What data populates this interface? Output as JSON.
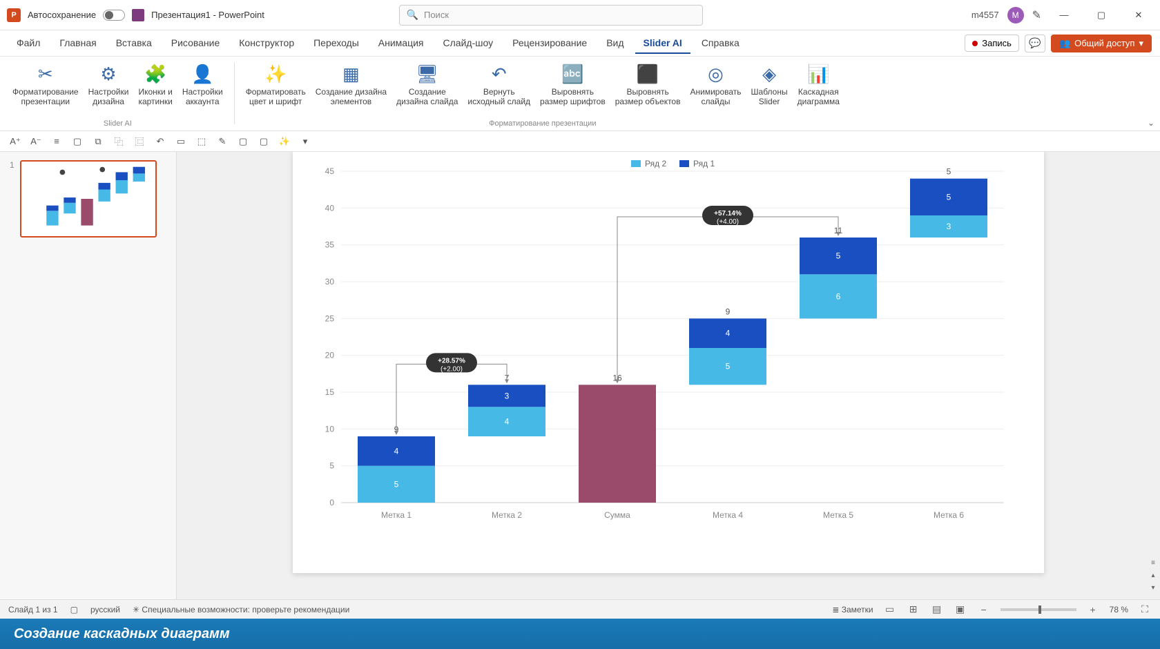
{
  "titlebar": {
    "autosave_label": "Автосохранение",
    "doc_title": "Презентация1 - PowerPoint",
    "search_placeholder": "Поиск",
    "user_name": "m4557",
    "avatar_letter": "M"
  },
  "tabs": {
    "items": [
      "Файл",
      "Главная",
      "Вставка",
      "Рисование",
      "Конструктор",
      "Переходы",
      "Анимация",
      "Слайд-шоу",
      "Рецензирование",
      "Вид",
      "Slider AI",
      "Справка"
    ],
    "active_index": 10,
    "record_label": "Запись",
    "share_label": "Общий доступ"
  },
  "ribbon": {
    "group1_label": "Slider AI",
    "group2_label": "Форматирование презентации",
    "buttons1": [
      {
        "label": "Форматирование\nпрезентации",
        "icon": "✂"
      },
      {
        "label": "Настройки\nдизайна",
        "icon": "⚙"
      },
      {
        "label": "Иконки и\nкартинки",
        "icon": "🧩"
      },
      {
        "label": "Настройки\nаккаунта",
        "icon": "👤"
      }
    ],
    "buttons2": [
      {
        "label": "Форматировать\nцвет и шрифт",
        "icon": "✨"
      },
      {
        "label": "Создание дизайна\nэлементов",
        "icon": "▦"
      },
      {
        "label": "Создание\nдизайна слайда",
        "icon": "🖥"
      },
      {
        "label": "Вернуть\nисходный слайд",
        "icon": "↶"
      },
      {
        "label": "Выровнять\nразмер шрифтов",
        "icon": "🔤"
      },
      {
        "label": "Выровнять\nразмер объектов",
        "icon": "⬛"
      },
      {
        "label": "Анимировать\nслайды",
        "icon": "◎"
      },
      {
        "label": "Шаблоны\nSlider",
        "icon": "◈"
      },
      {
        "label": "Каскадная\nдиаграмма",
        "icon": "📊"
      }
    ]
  },
  "qat": [
    "A⁺",
    "A⁻",
    "≡",
    "▢",
    "⧉",
    "⿻",
    "⿷",
    "↶",
    "▭",
    "⬚",
    "✎",
    "▢",
    "▢",
    "✨",
    "▾"
  ],
  "thumbnails": {
    "slide_number": "1"
  },
  "statusbar": {
    "slide_counter": "Слайд 1 из 1",
    "language": "русский",
    "accessibility": "Специальные возможности: проверьте рекомендации",
    "notes_label": "Заметки",
    "zoom_level": "78 %"
  },
  "caption": "Создание каскадных диаграмм",
  "chart_data": {
    "type": "bar",
    "legend": [
      "Ряд 2",
      "Ряд 1"
    ],
    "categories": [
      "Метка 1",
      "Метка 2",
      "Сумма",
      "Метка 4",
      "Метка 5",
      "Метка 6"
    ],
    "y_ticks": [
      0,
      5,
      10,
      15,
      20,
      25,
      30,
      35,
      40,
      45
    ],
    "ylim": [
      0,
      45
    ],
    "series": [
      {
        "name": "Ряд 1",
        "color": "#46b9e6"
      },
      {
        "name": "Ряд 2",
        "color": "#1a4fc1"
      }
    ],
    "bars": [
      {
        "category": "Метка 1",
        "base": 0,
        "seg1": 5,
        "seg2": 4,
        "total": 9,
        "type": "stack"
      },
      {
        "category": "Метка 2",
        "base": 9,
        "seg1": 4,
        "seg2": 3,
        "total": 7,
        "type": "stack"
      },
      {
        "category": "Сумма",
        "base": 0,
        "value": 16,
        "type": "sum",
        "color": "#9a4a6a"
      },
      {
        "category": "Метка 4",
        "base": 16,
        "seg1": 5,
        "seg2": 4,
        "total": 9,
        "type": "stack"
      },
      {
        "category": "Метка 5",
        "base": 25,
        "seg1": 6,
        "seg2": 5,
        "total": 11,
        "type": "stack"
      },
      {
        "category": "Метка 6",
        "base": 36,
        "seg1": 3,
        "seg2": 5,
        "total": 5,
        "type": "stack",
        "note": "label shows 5"
      }
    ],
    "callouts": [
      {
        "text": "+28.57%\n(+2.00)",
        "x_between": [
          0,
          1
        ]
      },
      {
        "text": "+57.14%\n(+4.00)",
        "x_between": [
          2,
          4
        ]
      }
    ]
  }
}
